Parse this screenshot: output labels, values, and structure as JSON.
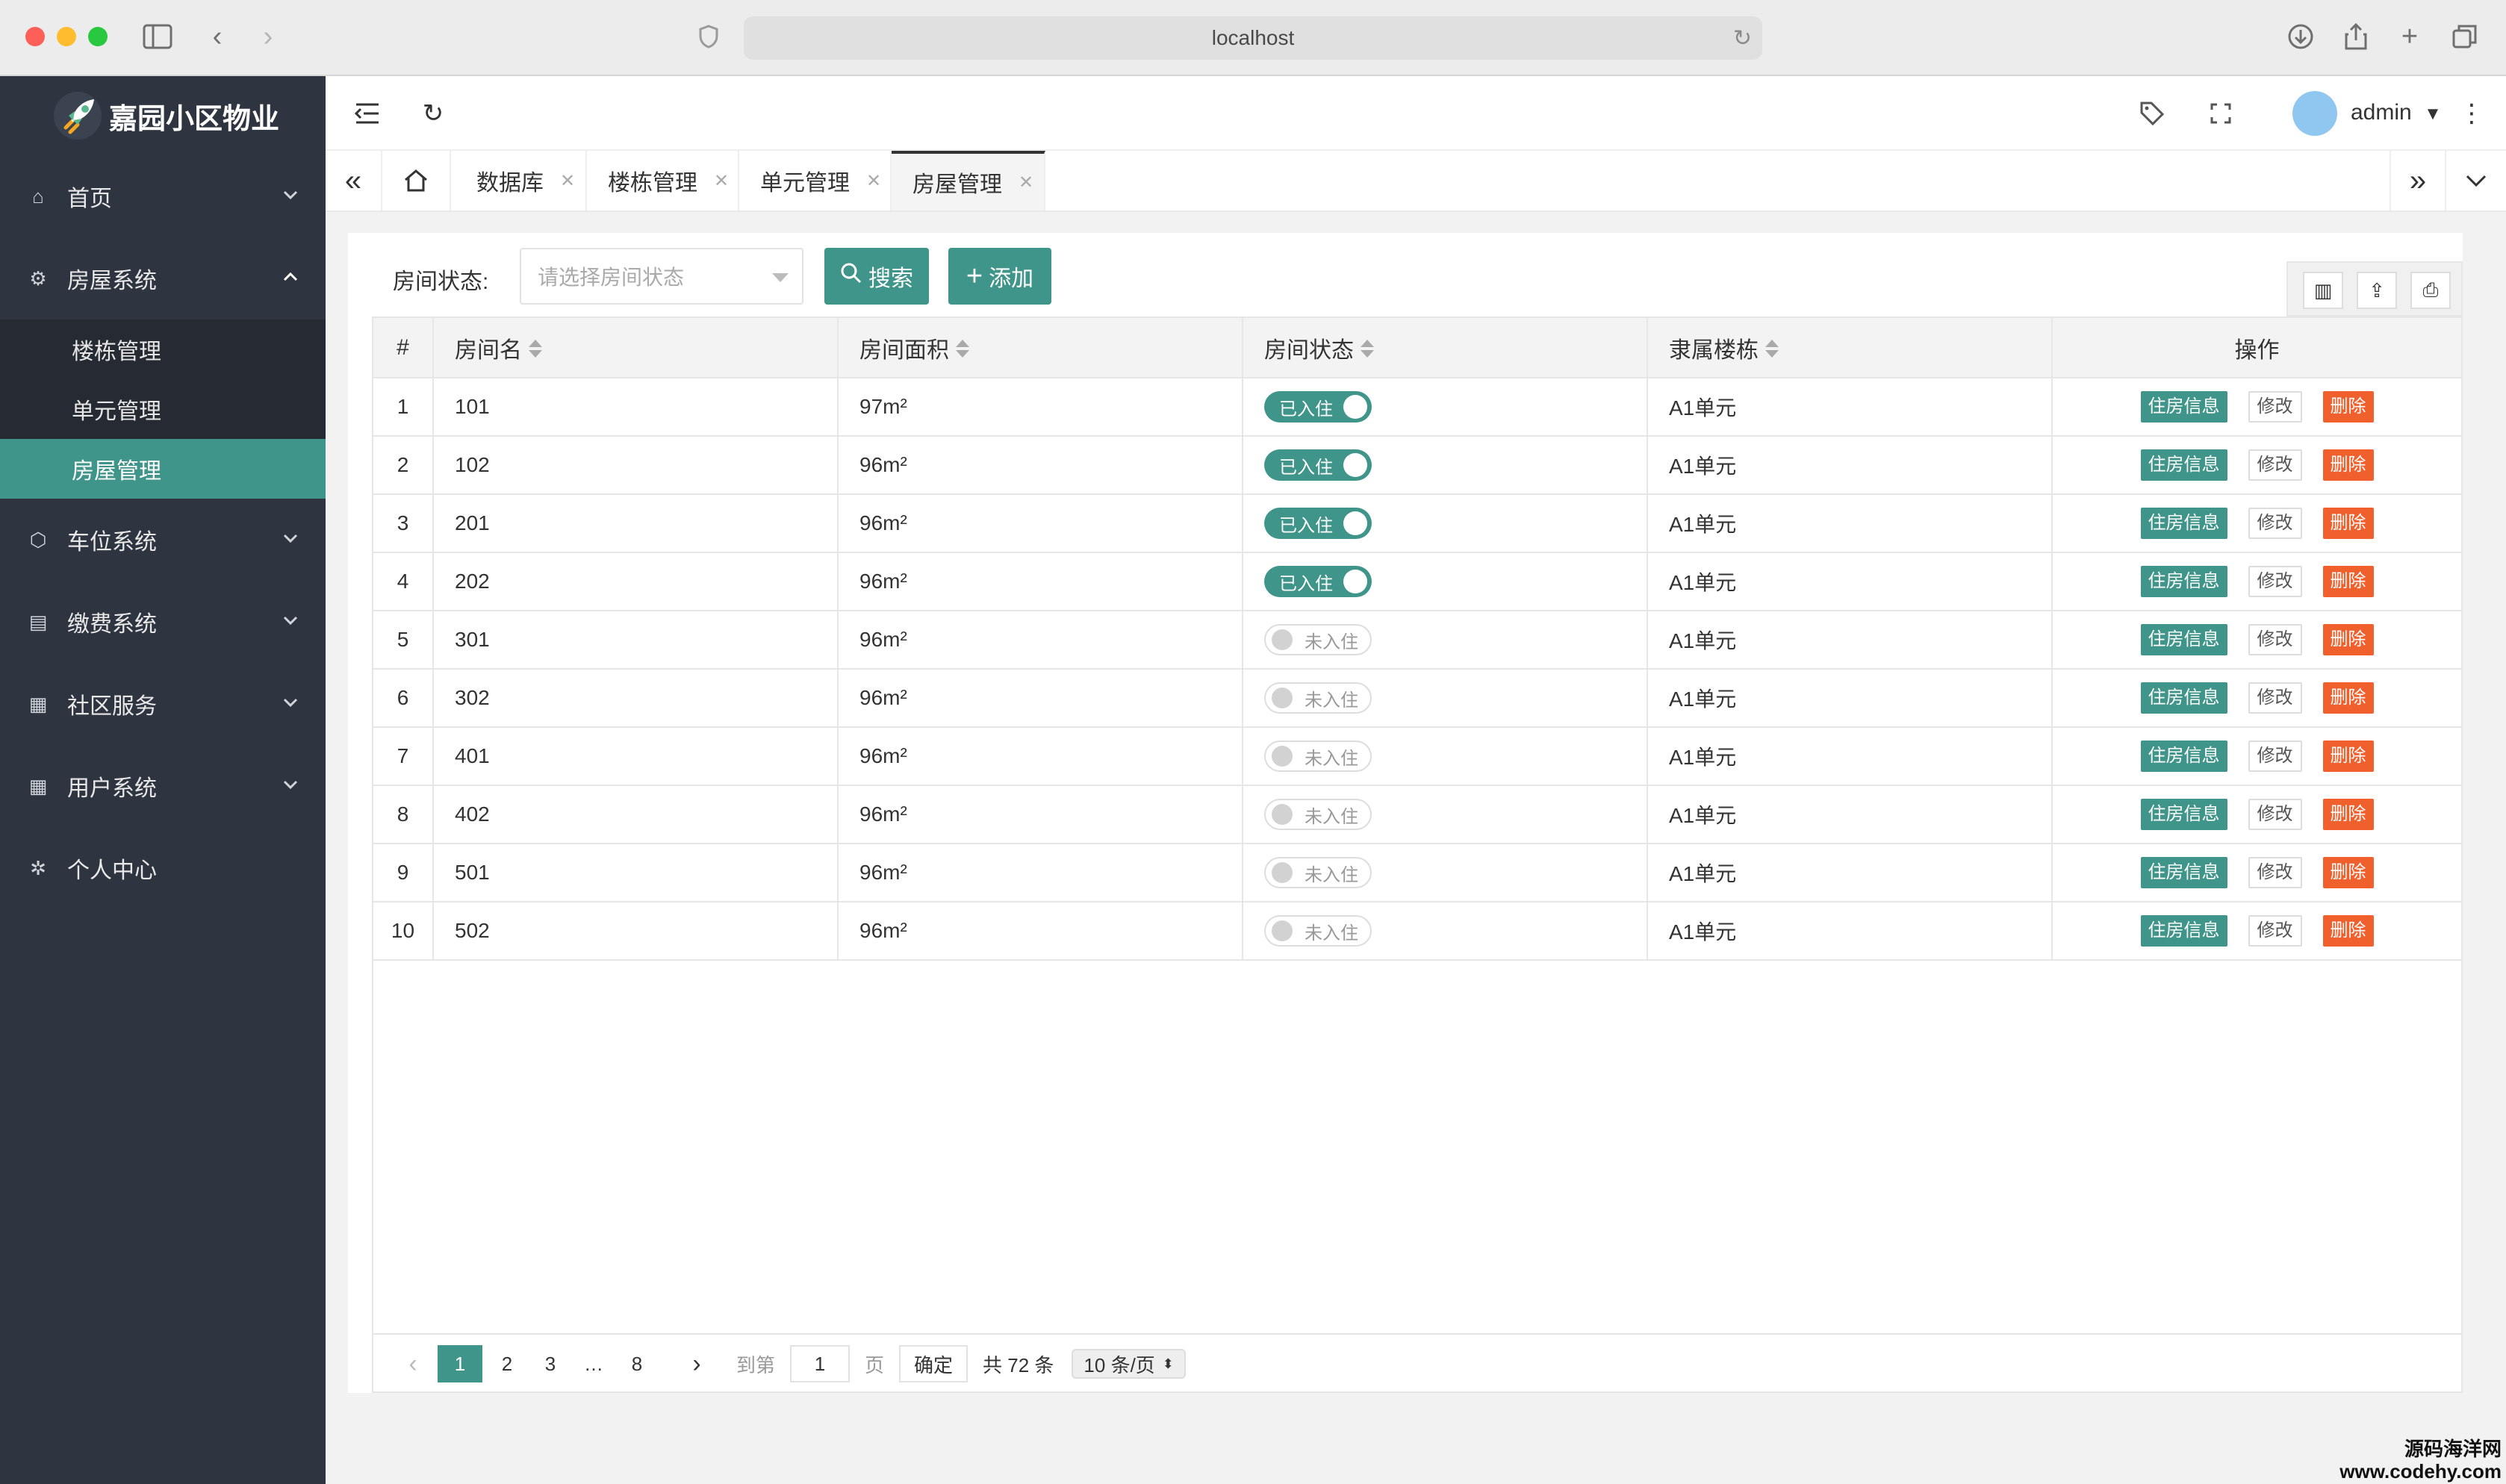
{
  "browser": {
    "url": "localhost"
  },
  "brand": {
    "title": "嘉园小区物业"
  },
  "sidebar": {
    "items": [
      {
        "label": "首页"
      },
      {
        "label": "房屋系统"
      },
      {
        "label": "车位系统"
      },
      {
        "label": "缴费系统"
      },
      {
        "label": "社区服务"
      },
      {
        "label": "用户系统"
      },
      {
        "label": "个人中心"
      }
    ],
    "sub_items": [
      {
        "label": "楼栋管理"
      },
      {
        "label": "单元管理"
      },
      {
        "label": "房屋管理"
      }
    ]
  },
  "header": {
    "user": "admin"
  },
  "tabs": [
    {
      "label": "数据库"
    },
    {
      "label": "楼栋管理"
    },
    {
      "label": "单元管理"
    },
    {
      "label": "房屋管理"
    }
  ],
  "filter": {
    "label": "房间状态:",
    "placeholder": "请选择房间状态",
    "search": "搜索",
    "add": "添加"
  },
  "table": {
    "headers": [
      "#",
      "房间名",
      "房间面积",
      "房间状态",
      "隶属楼栋",
      "操作"
    ],
    "ops": {
      "info": "住房信息",
      "edit": "修改",
      "delete": "删除"
    },
    "rows": [
      {
        "idx": "1",
        "name": "101",
        "area": "97m²",
        "status": "已入住",
        "building": "A1单元"
      },
      {
        "idx": "2",
        "name": "102",
        "area": "96m²",
        "status": "已入住",
        "building": "A1单元"
      },
      {
        "idx": "3",
        "name": "201",
        "area": "96m²",
        "status": "已入住",
        "building": "A1单元"
      },
      {
        "idx": "4",
        "name": "202",
        "area": "96m²",
        "status": "已入住",
        "building": "A1单元"
      },
      {
        "idx": "5",
        "name": "301",
        "area": "96m²",
        "status": "未入住",
        "building": "A1单元"
      },
      {
        "idx": "6",
        "name": "302",
        "area": "96m²",
        "status": "未入住",
        "building": "A1单元"
      },
      {
        "idx": "7",
        "name": "401",
        "area": "96m²",
        "status": "未入住",
        "building": "A1单元"
      },
      {
        "idx": "8",
        "name": "402",
        "area": "96m²",
        "status": "未入住",
        "building": "A1单元"
      },
      {
        "idx": "9",
        "name": "501",
        "area": "96m²",
        "status": "未入住",
        "building": "A1单元"
      },
      {
        "idx": "10",
        "name": "502",
        "area": "96m²",
        "status": "未入住",
        "building": "A1单元"
      }
    ]
  },
  "pager": {
    "pages": [
      "1",
      "2",
      "3",
      "…",
      "8"
    ],
    "goto_label": "到第",
    "goto_value": "1",
    "page_unit": "页",
    "confirm": "确定",
    "total": "共 72 条",
    "page_size": "10 条/页"
  },
  "watermark": {
    "line1": "源码海洋网",
    "line2": "www.codehy.com"
  },
  "colors": {
    "accent": "#3f9589",
    "danger": "#f0602d",
    "sidebar": "#2f3540"
  }
}
